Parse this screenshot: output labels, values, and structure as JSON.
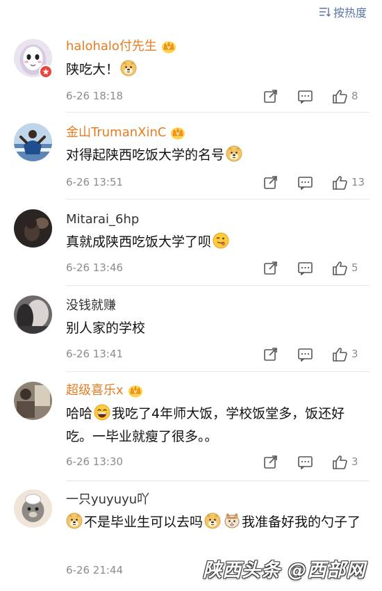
{
  "header": {
    "sort_label": "按热度",
    "sort_icon": "sort-icon"
  },
  "comments": [
    {
      "username": "halohalo付先生",
      "vip": true,
      "text_before": "陕吃大！",
      "emoji": "doge",
      "text_after": "",
      "time": "6-26 18:18",
      "likes": "8"
    },
    {
      "username": "金山TrumanXinC",
      "vip": true,
      "text_before": "对得起陕西吃饭大学的名号",
      "emoji": "doge",
      "text_after": "",
      "time": "6-26 13:51",
      "likes": "13"
    },
    {
      "username": "Mitarai_6hp",
      "vip": false,
      "text_before": "真就成陕西吃饭大学了呗",
      "emoji": "tongue",
      "text_after": "",
      "time": "6-26 13:46",
      "likes": "5"
    },
    {
      "username": "没钱就赚",
      "vip": false,
      "text_before": "别人家的学校",
      "emoji": "",
      "text_after": "",
      "time": "6-26 13:41",
      "likes": "3"
    },
    {
      "username": "超级喜乐x",
      "vip": true,
      "text_before": "哈哈",
      "emoji": "laugh",
      "text_after": "我吃了4年师大饭，学校饭堂多，饭还好吃。一毕业就瘦了很多。。",
      "time": "6-26 13:30",
      "likes": "3"
    },
    {
      "username": "一只yuyuyu吖",
      "vip": false,
      "text_prefix_emoji": "doge",
      "text_before": "不是毕业生可以去吗",
      "emoji": "doge",
      "emoji2": "cat",
      "text_after": "我准备好我的勺子了",
      "time": "6-26 21:44",
      "likes": ""
    }
  ],
  "watermark": "陕西头条 @西部网",
  "colors": {
    "vip_name": "#ea7b21",
    "accent_blue": "#5a73a8",
    "meta_gray": "#8c8c8c",
    "vip_badge": "#e8453c"
  }
}
